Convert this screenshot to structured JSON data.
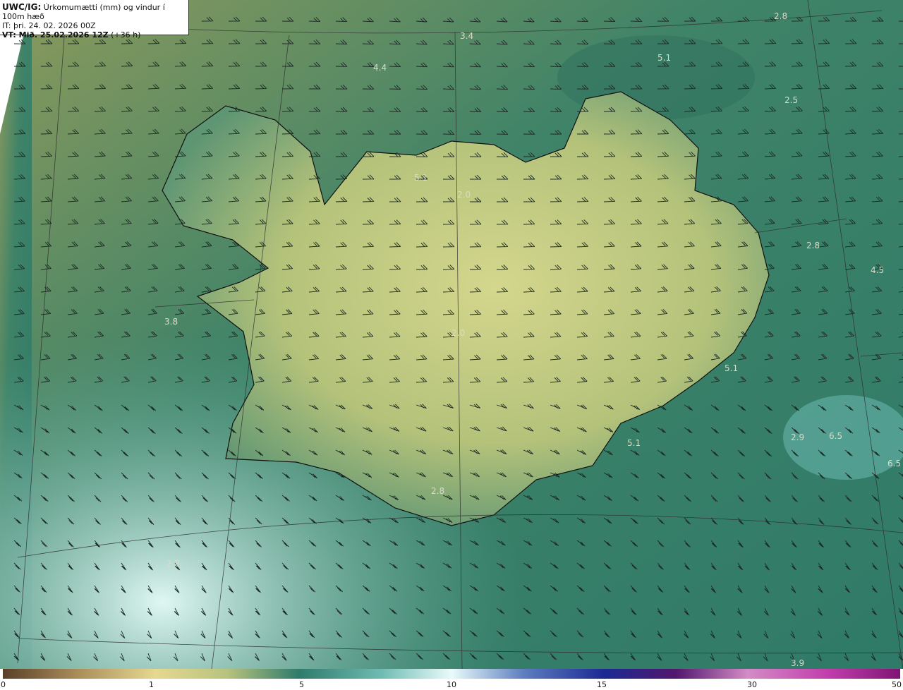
{
  "header": {
    "product": "UWC/IG:",
    "title": "Úrkomumætti (mm) og vindur í 100m hæð",
    "init_time": "IT: þri. 24. 02. 2026 00Z",
    "valid_label": "VT: Mið. 25.02.2026 12Z",
    "lead": "(+36 h)"
  },
  "colorbar": {
    "ticks": [
      "0",
      "1",
      "5",
      "10",
      "15",
      "30",
      "50"
    ]
  },
  "labels": [
    "2.8",
    "3.4",
    "4.4",
    "5.1",
    "2.5",
    "5.1",
    "2.0",
    "3.8",
    "4.5",
    "5.1",
    "5.1",
    "2.9",
    "6.5",
    "6.5",
    "2.0",
    "2.8",
    "3.9",
    "2.8",
    "2.8"
  ],
  "colors": {
    "sea": "#3f8a73",
    "land": "#c9cf86",
    "coast": "#111111"
  }
}
